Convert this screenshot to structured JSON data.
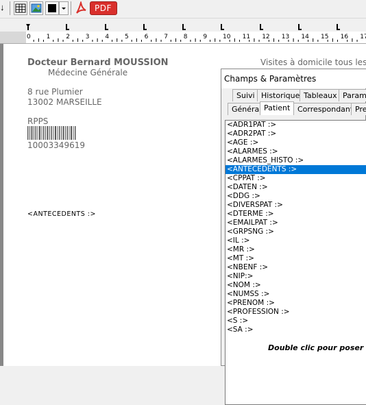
{
  "toolbar": {
    "left_glyph": "↓",
    "pdf_label": "PDF",
    "icons": [
      "table-icon",
      "image-icon",
      "color-icon",
      "dropdown-icon",
      "acrobat-icon",
      "pdf-icon"
    ]
  },
  "ruler": {
    "numbers": [
      "0",
      "1",
      "2",
      "3",
      "4",
      "5",
      "6",
      "7",
      "8",
      "9",
      "10",
      "11",
      "12",
      "13",
      "14",
      "15",
      "16",
      "17"
    ]
  },
  "document": {
    "doctor_name": "Docteur Bernard MOUSSION",
    "specialty": "Médecine Générale",
    "address_line1": "8 rue Plumier",
    "address_line2": "13002 MARSEILLE",
    "rpps_label": "RPPS",
    "rpps_number": "10003349619",
    "field_placeholder": "<ANTECEDENTS :>",
    "visits_text": "Visites à domicile tous les jou"
  },
  "panel": {
    "title": "Champs & Paramètres",
    "tabs_row1": [
      "Suivi",
      "Historique",
      "Tableaux",
      "Paramè"
    ],
    "tabs_row2": [
      "Général",
      "Patient",
      "Correspondant",
      "Pre"
    ],
    "active_tab": "Patient",
    "fields": [
      "<ADR1PAT :>",
      "<ADR2PAT :>",
      "<AGE :>",
      "<ALARMES :>",
      "<ALARMES_HISTO :>",
      "<ANTECEDENTS :>",
      "<CPPAT :>",
      "<DATEN :>",
      "<DDG :>",
      "<DIVERSPAT :>",
      "<DTERME :>",
      "<EMAILPAT :>",
      "<GRPSNG :>",
      "<IL :>",
      "<MR :>",
      "<MT :>",
      "<NBENF :>",
      "<NIP:>",
      "<NOM :>",
      "<NUMSS :>",
      "<PRENOM :>",
      "<PROFESSION :>",
      "<S :>",
      "<SA :>"
    ],
    "selected_field": "<ANTECEDENTS :>",
    "hint": "Double clic pour poser un"
  },
  "colors": {
    "selection": "#0078d7",
    "pdf_button": "#d9302c",
    "doc_text": "#666666"
  }
}
